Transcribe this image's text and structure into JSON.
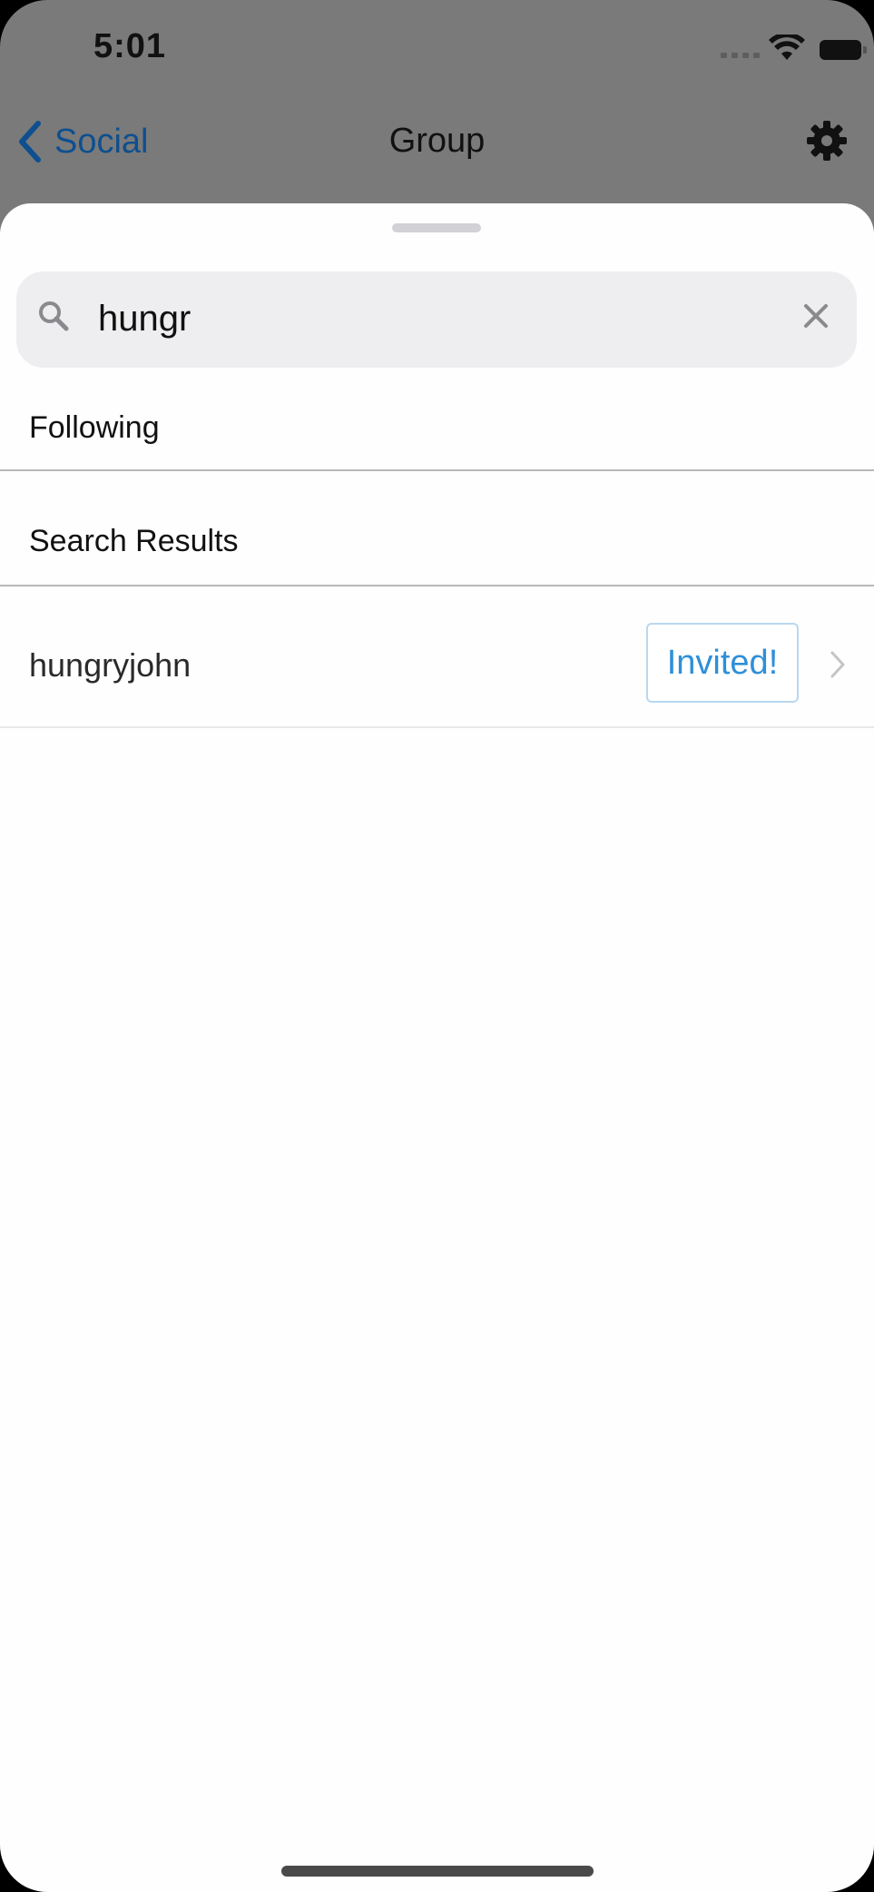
{
  "status_bar": {
    "time": "5:01"
  },
  "nav": {
    "back_label": "Social",
    "title": "Group"
  },
  "search": {
    "value": "hungr"
  },
  "sections": {
    "following": "Following",
    "search_results": "Search Results"
  },
  "results": [
    {
      "username": "hungryjohn",
      "action_label": "Invited!"
    }
  ],
  "colors": {
    "accent": "#2f8fd8",
    "nav_link": "#0e4f8f",
    "dim_backdrop": "#7a7a7a",
    "sheet_bg": "#fefefe",
    "search_bg": "#eeeef0"
  },
  "icons": [
    "signal-icon",
    "wifi-icon",
    "battery-icon",
    "back-chevron-icon",
    "gear-icon",
    "search-icon",
    "clear-icon",
    "chevron-right-icon"
  ]
}
